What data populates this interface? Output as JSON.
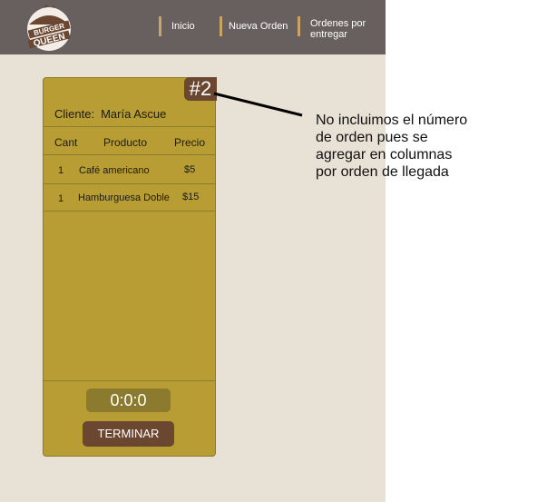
{
  "nav": {
    "logo_text": "BURGER QUEEN",
    "items": [
      {
        "label": "Inicio"
      },
      {
        "label": "Nueva Orden"
      },
      {
        "label_line1": "Ordenes por",
        "label_line2": "entregar"
      }
    ]
  },
  "order": {
    "number": "#2",
    "client_label": "Cliente:",
    "client_name": "María Ascue",
    "columns": [
      "Cant",
      "Producto",
      "Precio"
    ],
    "items": [
      {
        "qty": "1",
        "product": "Café americano",
        "price": "$5"
      },
      {
        "qty": "1",
        "product": "Hamburguesa Doble",
        "price": "$15"
      }
    ],
    "timer": "0:0:0",
    "finish_label": "TERMINAR"
  },
  "annotation": {
    "lines": [
      "No incluimos el número",
      "de orden pues se",
      "agregar en columnas",
      "por orden de llegada"
    ]
  },
  "colors": {
    "navbar": "#67605f",
    "background": "#e8e1d5",
    "card": "#b79d34",
    "accent_brown": "#6b4630",
    "nav_separator": "#c9a467"
  }
}
